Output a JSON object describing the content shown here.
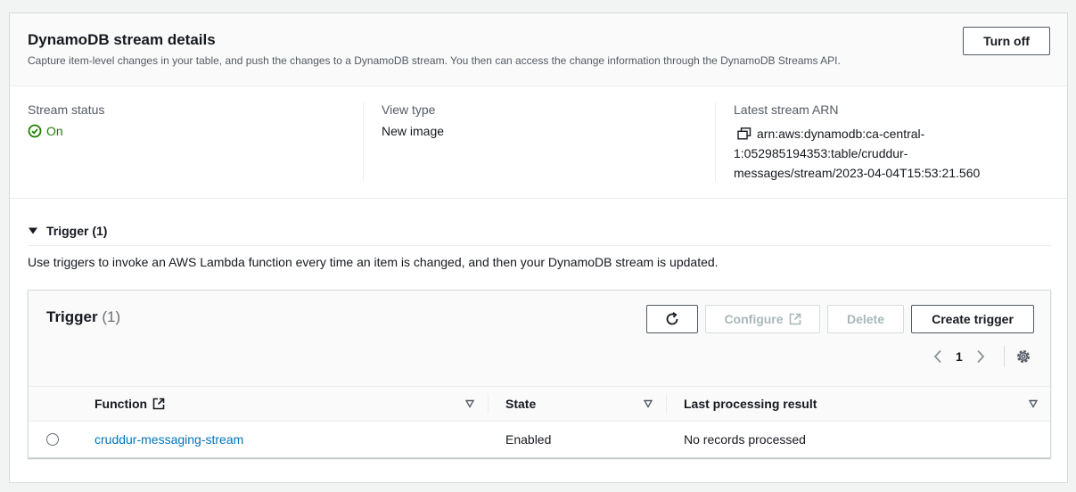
{
  "header": {
    "title": "DynamoDB stream details",
    "description": "Capture item-level changes in your table, and push the changes to a DynamoDB stream. You then can access the change information through the DynamoDB Streams API.",
    "turn_off_label": "Turn off"
  },
  "details": {
    "status_label": "Stream status",
    "status_value": "On",
    "view_type_label": "View type",
    "view_type_value": "New image",
    "arn_label": "Latest stream ARN",
    "arn_value": "arn:aws:dynamodb:ca-central-1:052985194353:table/cruddur-messages/stream/2023-04-04T15:53:21.560"
  },
  "trigger_section": {
    "expander_label": "Trigger (1)",
    "description": "Use triggers to invoke an AWS Lambda function every time an item is changed, and then your DynamoDB stream is updated."
  },
  "trigger_table": {
    "title": "Trigger",
    "count": "(1)",
    "configure_label": "Configure",
    "delete_label": "Delete",
    "create_label": "Create trigger",
    "page": "1",
    "columns": {
      "function": "Function",
      "state": "State",
      "last_result": "Last processing result"
    },
    "rows": [
      {
        "function": "cruddur-messaging-stream",
        "state": "Enabled",
        "last_result": "No records processed"
      }
    ]
  },
  "colors": {
    "accent_link": "#0073bb",
    "status_green": "#1d8102",
    "text": "#16191f",
    "muted": "#545b64"
  },
  "icons": [
    "check-circle-icon",
    "copy-icon",
    "caret-down-icon",
    "refresh-icon",
    "external-link-icon",
    "chevron-left-icon",
    "chevron-right-icon",
    "gear-icon",
    "sort-icon"
  ]
}
